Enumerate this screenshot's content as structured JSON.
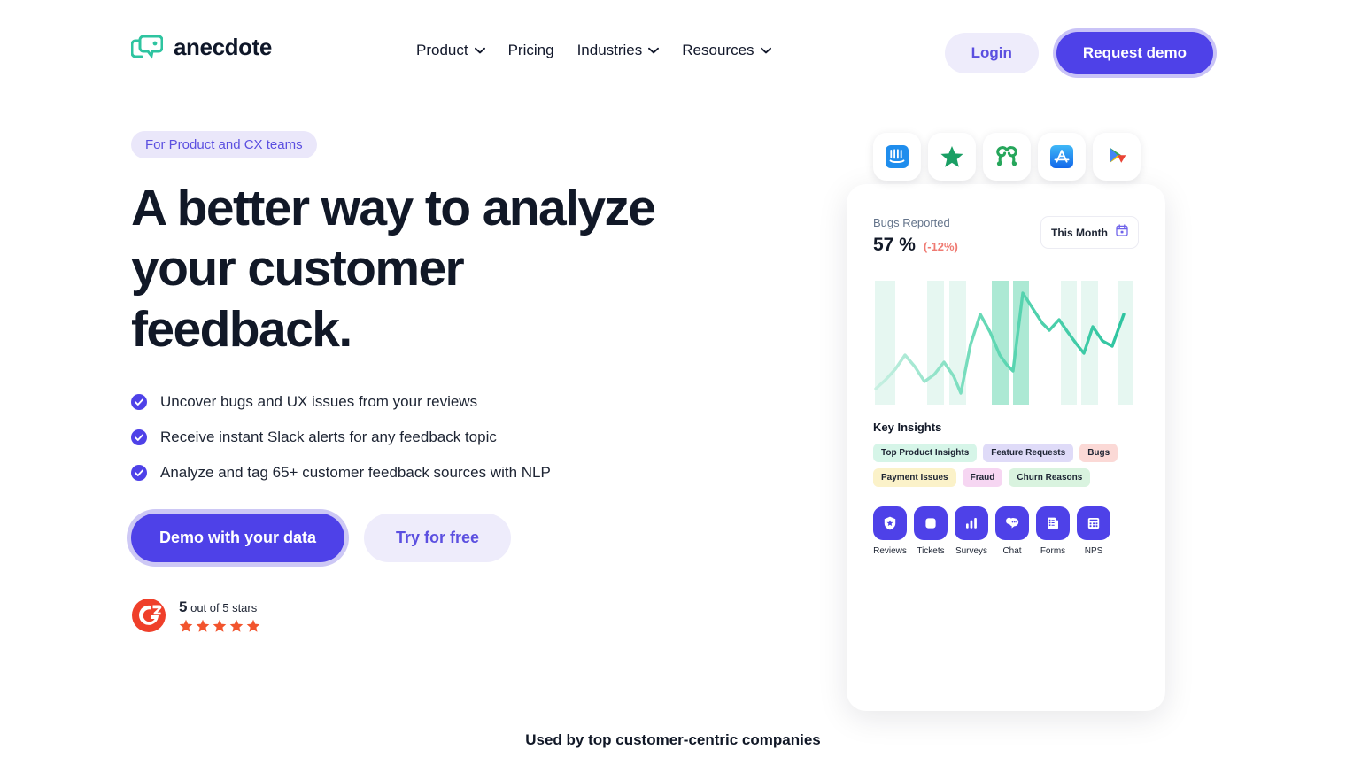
{
  "brand": {
    "name": "anecdote",
    "logo_icon": "anecdote-speech-bubbles-logo",
    "color": "#2ec4a0"
  },
  "nav": {
    "items": [
      {
        "label": "Product",
        "has_dropdown": true
      },
      {
        "label": "Pricing",
        "has_dropdown": false
      },
      {
        "label": "Industries",
        "has_dropdown": true
      },
      {
        "label": "Resources",
        "has_dropdown": true
      }
    ]
  },
  "auth": {
    "login_label": "Login",
    "demo_label": "Request demo"
  },
  "hero": {
    "eyebrow": "For Product and CX teams",
    "headline": "A better way to analyze your customer feedback.",
    "bullets": [
      "Uncover bugs and UX issues from your reviews",
      "Receive instant Slack alerts for any feedback topic",
      "Analyze and tag 65+ customer feedback sources with NLP"
    ],
    "primary_cta": "Demo with your data",
    "secondary_cta": "Try for free"
  },
  "g2": {
    "logo_icon": "g2-badge-icon",
    "score": "5",
    "score_suffix": "out of 5 stars",
    "stars": 5,
    "star_color": "#f2542d"
  },
  "app_icons": [
    {
      "name": "intercom-icon"
    },
    {
      "name": "trustpilot-star-icon"
    },
    {
      "name": "capterra-icon"
    },
    {
      "name": "app-store-icon"
    },
    {
      "name": "google-play-icon"
    }
  ],
  "dashboard": {
    "stat_label": "Bugs Reported",
    "stat_value": "57 %",
    "stat_delta": "(-12%)",
    "period_label": "This Month",
    "period_icon": "calendar-icon",
    "insights_title": "Key Insights",
    "tags": [
      {
        "label": "Top Product Insights",
        "bg": "#d6f5e8",
        "fg": "#1d2433"
      },
      {
        "label": "Feature Requests",
        "bg": "#dfdbf8",
        "fg": "#1d2433"
      },
      {
        "label": "Bugs",
        "bg": "#fbd9d6",
        "fg": "#1d2433"
      },
      {
        "label": "Payment Issues",
        "bg": "#fbf2c9",
        "fg": "#1d2433"
      },
      {
        "label": "Fraud",
        "bg": "#f6d6f2",
        "fg": "#1d2433"
      },
      {
        "label": "Churn Reasons",
        "bg": "#d9f3df",
        "fg": "#1d2433"
      }
    ],
    "tools": [
      {
        "label": "Reviews",
        "icon": "star-badge-icon"
      },
      {
        "label": "Tickets",
        "icon": "ticket-square-icon"
      },
      {
        "label": "Surveys",
        "icon": "bar-chart-icon"
      },
      {
        "label": "Chat",
        "icon": "chat-bubbles-icon"
      },
      {
        "label": "Forms",
        "icon": "form-document-icon"
      },
      {
        "label": "NPS",
        "icon": "calculator-icon"
      }
    ]
  },
  "chart_data": {
    "type": "line",
    "title": "Bugs Reported",
    "xlabel": "",
    "ylabel": "",
    "grid": false,
    "legend": "none",
    "line_color_start": "#bfeede",
    "line_color_end": "#2ec4a0",
    "band_color": "#d8f3ea",
    "ylim": [
      0,
      100
    ],
    "x": [
      0,
      1,
      2,
      3,
      4,
      5,
      6,
      7,
      8,
      9,
      10,
      11,
      12,
      13,
      14,
      15,
      16,
      17,
      18,
      19,
      20,
      21,
      22,
      23,
      24,
      25,
      26
    ],
    "values": [
      12,
      20,
      28,
      45,
      32,
      18,
      24,
      38,
      20,
      8,
      55,
      78,
      62,
      45,
      38,
      30,
      98,
      86,
      72,
      66,
      74,
      66,
      52,
      42,
      62,
      50,
      44
    ],
    "highlight_bands": [
      {
        "x_start": 0.2,
        "x_end": 2.4,
        "opacity": 0.45
      },
      {
        "x_start": 5.6,
        "x_end": 7.4,
        "opacity": 0.45
      },
      {
        "x_start": 7.9,
        "x_end": 9.6,
        "opacity": 0.45
      },
      {
        "x_start": 12.2,
        "x_end": 14.0,
        "opacity": 1.0
      },
      {
        "x_start": 14.4,
        "x_end": 16.0,
        "opacity": 1.0
      },
      {
        "x_start": 19.4,
        "x_end": 21.0,
        "opacity": 0.45
      },
      {
        "x_start": 21.5,
        "x_end": 23.3,
        "opacity": 0.45
      },
      {
        "x_start": 25.2,
        "x_end": 26.6,
        "opacity": 0.45
      }
    ]
  },
  "footer": {
    "used_by": "Used by top customer-centric companies"
  }
}
